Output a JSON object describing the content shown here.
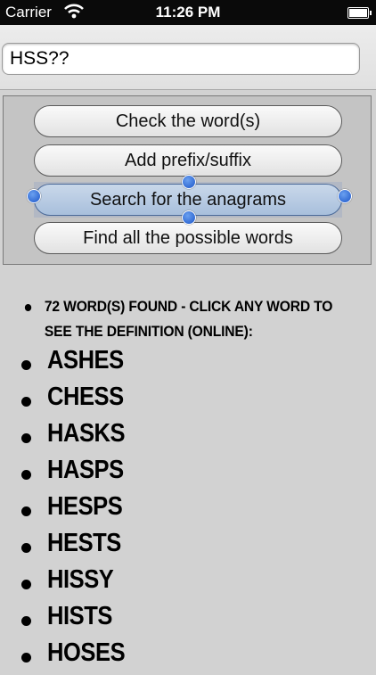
{
  "status_bar": {
    "carrier": "Carrier",
    "time": "11:26 PM"
  },
  "search": {
    "value": "HSS??"
  },
  "buttons": {
    "check": "Check the word(s)",
    "prefix": "Add prefix/suffix",
    "anagram": "Search for the anagrams",
    "findall": "Find all the possible words"
  },
  "results": {
    "summary": "72 WORD(S) FOUND - CLICK ANY WORD TO SEE THE DEFINITION (ONLINE):",
    "words": [
      "ASHES",
      "CHESS",
      "HASKS",
      "HASPS",
      "HESPS",
      "HESTS",
      "HISSY",
      "HISTS",
      "HOSES"
    ]
  },
  "colors": {
    "selected_button": "#a8bfdc",
    "handle": "#1d56c8"
  }
}
